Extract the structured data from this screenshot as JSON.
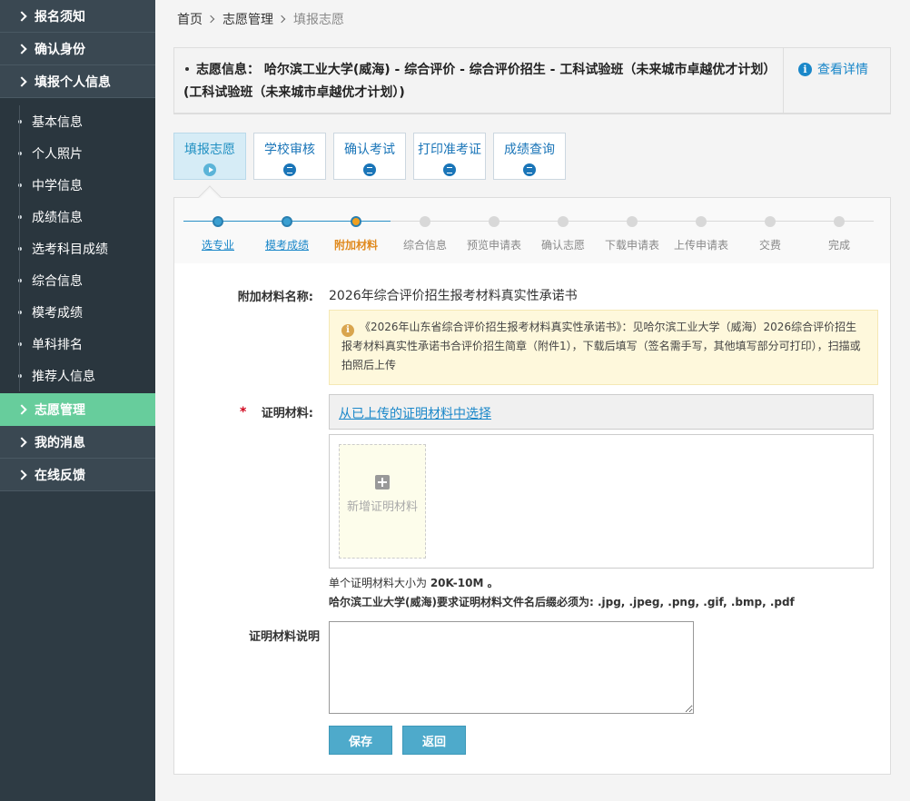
{
  "sidebar": {
    "top_items": [
      {
        "label": "报名须知"
      },
      {
        "label": "确认身份"
      },
      {
        "label": "填报个人信息"
      }
    ],
    "sub_items": [
      {
        "label": "基本信息"
      },
      {
        "label": "个人照片"
      },
      {
        "label": "中学信息"
      },
      {
        "label": "成绩信息"
      },
      {
        "label": "选考科目成绩"
      },
      {
        "label": "综合信息"
      },
      {
        "label": "模考成绩"
      },
      {
        "label": "单科排名"
      },
      {
        "label": "推荐人信息"
      }
    ],
    "active_item": {
      "label": "志愿管理"
    },
    "bottom_items": [
      {
        "label": "我的消息"
      },
      {
        "label": "在线反馈"
      }
    ]
  },
  "breadcrumb": {
    "home": "首页",
    "section": "志愿管理",
    "current": "填报志愿"
  },
  "info": {
    "label": "志愿信息：",
    "text_line1": "哈尔滨工业大学(威海) - 综合评价 - 综合评价招生 - 工科试验班（未来城市卓越优才计划）",
    "text_line2": "(工科试验班（未来城市卓越优才计划）)",
    "detail_link": "查看详情"
  },
  "step_tabs": [
    {
      "label": "填报志愿",
      "state": "active"
    },
    {
      "label": "学校审核",
      "state": "pending"
    },
    {
      "label": "确认考试",
      "state": "pending"
    },
    {
      "label": "打印准考证",
      "state": "pending"
    },
    {
      "label": "成绩查询",
      "state": "pending"
    }
  ],
  "progress_steps": [
    {
      "label": "选专业",
      "state": "done"
    },
    {
      "label": "模考成绩",
      "state": "done"
    },
    {
      "label": "附加材料",
      "state": "current"
    },
    {
      "label": "综合信息",
      "state": "todo"
    },
    {
      "label": "预览申请表",
      "state": "todo"
    },
    {
      "label": "确认志愿",
      "state": "todo"
    },
    {
      "label": "下载申请表",
      "state": "todo"
    },
    {
      "label": "上传申请表",
      "state": "todo"
    },
    {
      "label": "交费",
      "state": "todo"
    },
    {
      "label": "完成",
      "state": "todo"
    }
  ],
  "colors": {
    "done": "#2a8fc7",
    "current": "#f0a020",
    "todo": "#d8d8d8",
    "sidebar_active": "#67cd9c",
    "accent": "#4eaacb"
  },
  "form": {
    "material_name_label": "附加材料名称:",
    "material_name_value": "2026年综合评价招生报考材料真实性承诺书",
    "notice_text": "《2026年山东省综合评价招生报考材料真实性承诺书》：见哈尔滨工业大学（威海）2026综合评价招生报考材料真实性承诺书合评价招生简章（附件1），下载后填写（签名需手写，其他填写部分可打印），扫描或拍照后上传",
    "required_mark": "*",
    "proof_label": "证明材料:",
    "select_link": "从已上传的证明材料中选择",
    "add_tile_label": "新增证明材料",
    "hint1_prefix": "单个证明材料大小为 ",
    "hint1_bold": "20K-10M",
    "hint1_suffix": " 。",
    "hint2": "哈尔滨工业大学(威海)要求证明材料文件名后缀必须为: .jpg, .jpeg, .png, .gif, .bmp, .pdf",
    "desc_label": "证明材料说明",
    "desc_value": "",
    "save_button": "保存",
    "back_button": "返回"
  }
}
